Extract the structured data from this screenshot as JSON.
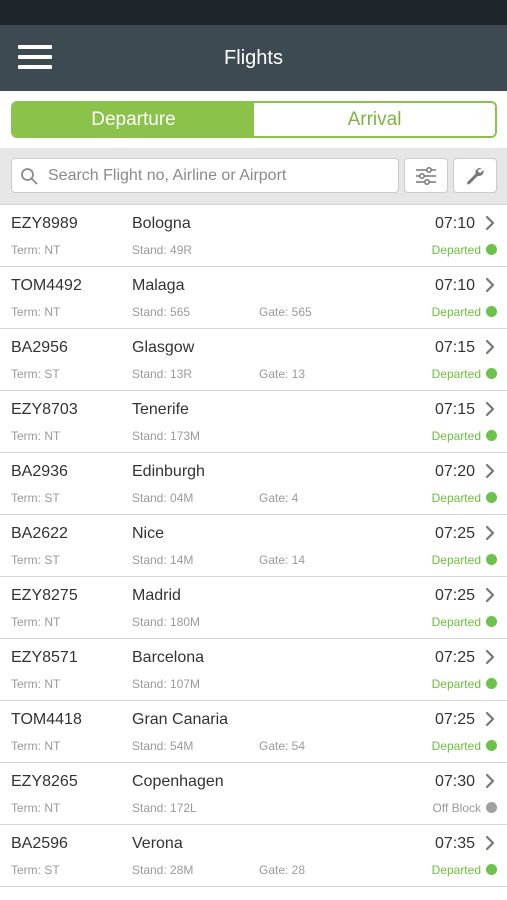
{
  "header": {
    "title": "Flights",
    "menu_icon": "hamburger-menu-icon"
  },
  "tabs": [
    {
      "label": "Departure",
      "active": true
    },
    {
      "label": "Arrival",
      "active": false
    }
  ],
  "search": {
    "placeholder": "Search Flight no, Airline or Airport",
    "value": "",
    "icon": "search-icon",
    "filter_icon": "filter-sliders-icon",
    "settings_icon": "wrench-icon"
  },
  "colors": {
    "app_bar": "#3d4a52",
    "status_bar": "#1e252a",
    "accent_green": "#8bc34a",
    "departed_green": "#6cbf3c",
    "off_block_grey": "#9a9a9a"
  },
  "flights": [
    {
      "code": "EZY8989",
      "destination": "Bologna",
      "time": "07:10",
      "terminal": "Term: NT",
      "stand": "Stand: 49R",
      "gate": "",
      "status": "Departed",
      "status_color": "green"
    },
    {
      "code": "TOM4492",
      "destination": "Malaga",
      "time": "07:10",
      "terminal": "Term: NT",
      "stand": "Stand: 565",
      "gate": "Gate: 565",
      "status": "Departed",
      "status_color": "green"
    },
    {
      "code": "BA2956",
      "destination": "Glasgow",
      "time": "07:15",
      "terminal": "Term: ST",
      "stand": "Stand: 13R",
      "gate": "Gate: 13",
      "status": "Departed",
      "status_color": "green"
    },
    {
      "code": "EZY8703",
      "destination": "Tenerife",
      "time": "07:15",
      "terminal": "Term: NT",
      "stand": "Stand: 173M",
      "gate": "",
      "status": "Departed",
      "status_color": "green"
    },
    {
      "code": "BA2936",
      "destination": "Edinburgh",
      "time": "07:20",
      "terminal": "Term: ST",
      "stand": "Stand: 04M",
      "gate": "Gate: 4",
      "status": "Departed",
      "status_color": "green"
    },
    {
      "code": "BA2622",
      "destination": "Nice",
      "time": "07:25",
      "terminal": "Term: ST",
      "stand": "Stand: 14M",
      "gate": "Gate: 14",
      "status": "Departed",
      "status_color": "green"
    },
    {
      "code": "EZY8275",
      "destination": "Madrid",
      "time": "07:25",
      "terminal": "Term: NT",
      "stand": "Stand: 180M",
      "gate": "",
      "status": "Departed",
      "status_color": "green"
    },
    {
      "code": "EZY8571",
      "destination": "Barcelona",
      "time": "07:25",
      "terminal": "Term: NT",
      "stand": "Stand: 107M",
      "gate": "",
      "status": "Departed",
      "status_color": "green"
    },
    {
      "code": "TOM4418",
      "destination": "Gran Canaria",
      "time": "07:25",
      "terminal": "Term: NT",
      "stand": "Stand: 54M",
      "gate": "Gate: 54",
      "status": "Departed",
      "status_color": "green"
    },
    {
      "code": "EZY8265",
      "destination": "Copenhagen",
      "time": "07:30",
      "terminal": "Term: NT",
      "stand": "Stand: 172L",
      "gate": "",
      "status": "Off Block",
      "status_color": "grey"
    },
    {
      "code": "BA2596",
      "destination": "Verona",
      "time": "07:35",
      "terminal": "Term: ST",
      "stand": "Stand: 28M",
      "gate": "Gate: 28",
      "status": "Departed",
      "status_color": "green"
    }
  ]
}
